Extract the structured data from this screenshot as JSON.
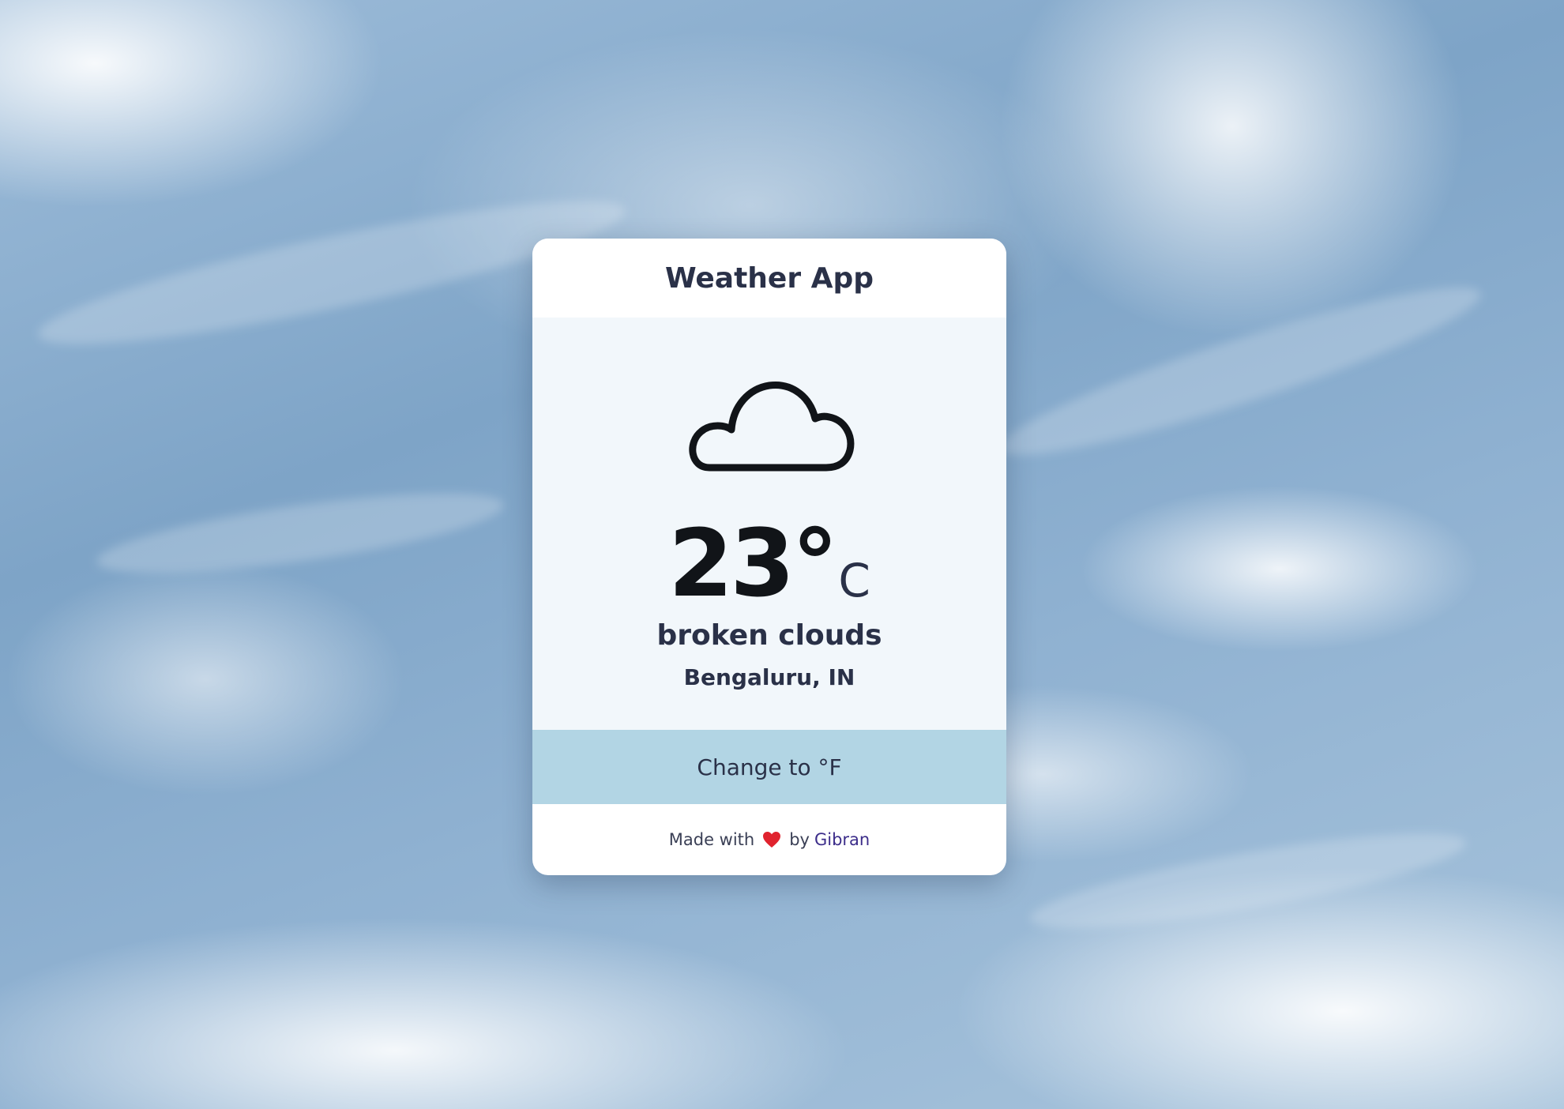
{
  "app": {
    "title": "Weather App"
  },
  "weather": {
    "icon": "cloud-icon",
    "temperature": "23°",
    "unit": "C",
    "condition": "broken clouds",
    "location": "Bengaluru, IN"
  },
  "toggle": {
    "label": "Change to °F"
  },
  "footer": {
    "made_with": "Made with",
    "heart_icon": "heart-icon",
    "by": "by",
    "author": "Gibran"
  },
  "colors": {
    "card_background": "#ffffff",
    "body_background": "#f2f7fb",
    "button_background": "#b2d5e4",
    "text_primary": "#2a3148",
    "author_link": "#3c2d8a",
    "heart": "#e0232e"
  }
}
